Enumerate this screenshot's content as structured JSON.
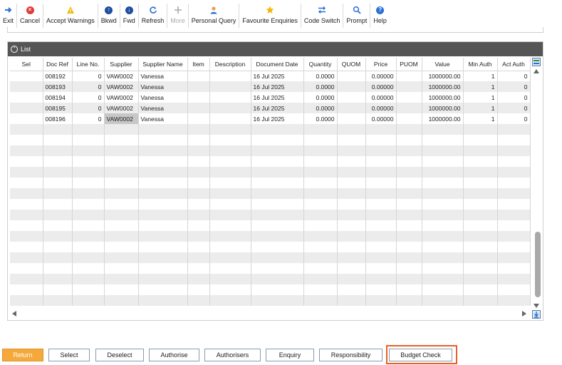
{
  "toolbar": {
    "items": [
      {
        "label": "Exit",
        "icon": "exit-arrow-icon"
      },
      {
        "label": "Cancel",
        "icon": "cancel-icon"
      },
      {
        "label": "Accept Warnings",
        "icon": "warning-icon"
      },
      {
        "label": "Bkwd",
        "icon": "up-arrow-icon"
      },
      {
        "label": "Fwd",
        "icon": "down-arrow-icon"
      },
      {
        "label": "Refresh",
        "icon": "refresh-icon"
      },
      {
        "label": "More",
        "icon": "plus-icon"
      },
      {
        "label": "Personal Query",
        "icon": "person-icon"
      },
      {
        "label": "Favourite Enquiries",
        "icon": "star-icon"
      },
      {
        "label": "Code Switch",
        "icon": "switch-icon"
      },
      {
        "label": "Prompt",
        "icon": "magnifier-icon"
      },
      {
        "label": "Help",
        "icon": "help-icon"
      }
    ]
  },
  "panel": {
    "title": "List",
    "columns": [
      "Sel",
      "Doc Ref",
      "Line No.",
      "Supplier",
      "Supplier Name",
      "Item",
      "Description",
      "Document Date",
      "Quantity",
      "QUOM",
      "Price",
      "PUOM",
      "Value",
      "Min Auth",
      "Act Auth"
    ],
    "rows": [
      {
        "sel": "",
        "doc_ref": "008192",
        "line_no": "0",
        "supplier": "VAW0002",
        "supplier_name": "Vanessa",
        "item": "",
        "description": "",
        "document_date": "16 Jul 2025",
        "quantity": "0.0000",
        "quom": "",
        "price": "0.00000",
        "puom": "",
        "value": "1000000.00",
        "min_auth": "1",
        "act_auth": "0"
      },
      {
        "sel": "",
        "doc_ref": "008193",
        "line_no": "0",
        "supplier": "VAW0002",
        "supplier_name": "Vanessa",
        "item": "",
        "description": "",
        "document_date": "16 Jul 2025",
        "quantity": "0.0000",
        "quom": "",
        "price": "0.00000",
        "puom": "",
        "value": "1000000.00",
        "min_auth": "1",
        "act_auth": "0"
      },
      {
        "sel": "",
        "doc_ref": "008194",
        "line_no": "0",
        "supplier": "VAW0002",
        "supplier_name": "Vanessa",
        "item": "",
        "description": "",
        "document_date": "16 Jul 2025",
        "quantity": "0.0000",
        "quom": "",
        "price": "0.00000",
        "puom": "",
        "value": "1000000.00",
        "min_auth": "1",
        "act_auth": "0"
      },
      {
        "sel": "",
        "doc_ref": "008195",
        "line_no": "0",
        "supplier": "VAW0002",
        "supplier_name": "Vanessa",
        "item": "",
        "description": "",
        "document_date": "16 Jul 2025",
        "quantity": "0.0000",
        "quom": "",
        "price": "0.00000",
        "puom": "",
        "value": "1000000.00",
        "min_auth": "1",
        "act_auth": "0"
      },
      {
        "sel": "",
        "doc_ref": "008196",
        "line_no": "0",
        "supplier": "VAW0002",
        "supplier_name": "Vanessa",
        "item": "",
        "description": "",
        "document_date": "16 Jul 2025",
        "quantity": "0.0000",
        "quom": "",
        "price": "0.00000",
        "puom": "",
        "value": "1000000.00",
        "min_auth": "1",
        "act_auth": "0"
      }
    ],
    "empty_row_count": 17
  },
  "buttons": {
    "return": "Return",
    "select": "Select",
    "deselect": "Deselect",
    "authorise": "Authorise",
    "authorisers": "Authorisers",
    "enquiry": "Enquiry",
    "responsibility": "Responsibility",
    "budget_check": "Budget Check"
  },
  "colors": {
    "primary_button": "#f5a93a",
    "focus_ring": "#e8602a",
    "panel_header": "#555555",
    "icon_blue": "#2a6fd6",
    "cancel_red": "#e03a3a",
    "warning_yellow": "#f2b700"
  }
}
